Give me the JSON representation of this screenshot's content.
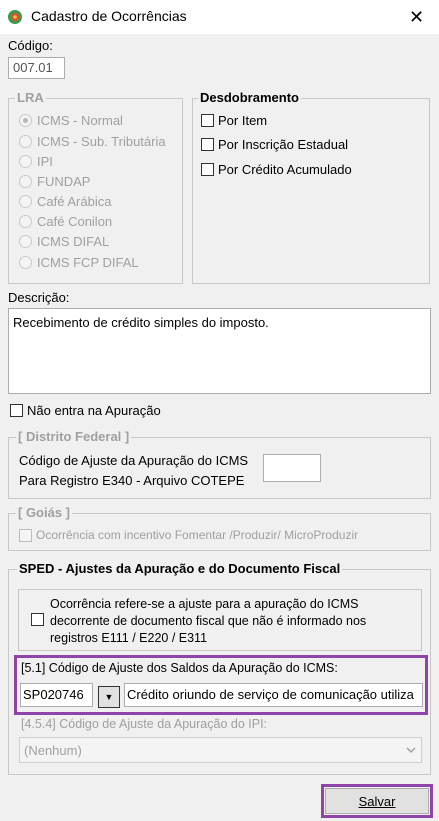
{
  "window": {
    "title": "Cadastro de Ocorrências",
    "close_glyph": "✕"
  },
  "codigo": {
    "label": "Código:",
    "value": "007.01"
  },
  "lra": {
    "legend": "LRA",
    "options": [
      "ICMS - Normal",
      "ICMS - Sub. Tributária",
      "IPI",
      "FUNDAP",
      "Café Arábica",
      "Café Conilon",
      "ICMS DIFAL",
      "ICMS FCP DIFAL"
    ],
    "selected": "ICMS - Normal"
  },
  "desdobramento": {
    "legend": "Desdobramento",
    "options": [
      "Por Item",
      "Por Inscrição Estadual",
      "Por Crédito Acumulado"
    ]
  },
  "descricao": {
    "label": "Descrição:",
    "value": "Recebimento de crédito simples do imposto."
  },
  "nao_entra": {
    "label": "Não entra na Apuração"
  },
  "distrito_federal": {
    "legend": "[ Distrito Federal ]",
    "line1": "Código de Ajuste da Apuração do ICMS",
    "line2": "Para Registro E340 - Arquivo COTEPE",
    "value": ""
  },
  "goias": {
    "legend": "[ Goiás ]",
    "checkbox_label": "Ocorrência com incentivo Fomentar /Produzir/ MicroProduzir"
  },
  "sped": {
    "legend": "SPED - Ajustes da Apuração e do Documento Fiscal",
    "ocorrencia_line1": "Ocorrência refere-se a ajuste para a apuração do ICMS",
    "ocorrencia_line2": "decorrente de documento fiscal que não é informado nos",
    "ocorrencia_line3": "registros E111 / E220 / E311",
    "icms_label": "[5.1] Código de Ajuste dos Saldos da Apuração do ICMS:",
    "icms_code": "SP020746",
    "icms_desc": "Crédito oriundo de serviço de comunicação utiliza",
    "ipi_label": "[4.5.4] Código de Ajuste da Apuração do IPI:",
    "ipi_value": "(Nenhum)"
  },
  "buttons": {
    "save": "Salvar"
  },
  "icons": {
    "app": "app-globe-icon",
    "dropdown": "chevron-down-icon",
    "close": "close-icon"
  },
  "colors": {
    "highlight": "#8e44a8"
  }
}
